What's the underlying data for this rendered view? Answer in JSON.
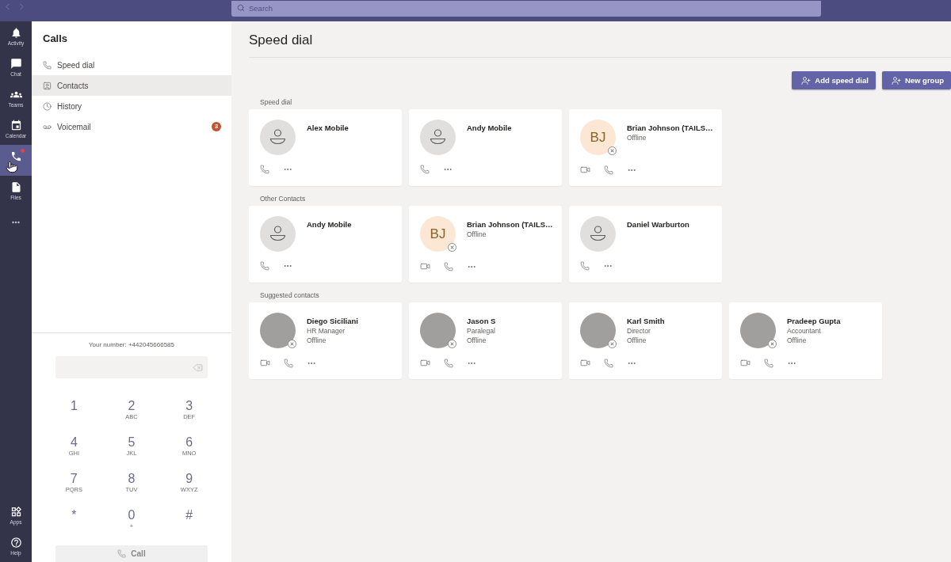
{
  "top_bar": {
    "history_buttons": [
      {
        "disabled": true
      },
      {
        "disabled": true
      }
    ],
    "search": {
      "placeholder": "Search"
    }
  },
  "app_bar": {
    "items": [
      {
        "label": "Activity",
        "selected": false,
        "notification": false
      },
      {
        "label": "Chat",
        "selected": false,
        "notification": false
      },
      {
        "label": "Teams",
        "selected": false,
        "notification": false
      },
      {
        "label": "Calendar",
        "selected": false,
        "notification": false
      },
      {
        "selected": true,
        "notification": true
      },
      {
        "label": "Files",
        "selected": false,
        "notification": false
      }
    ],
    "bottom_items": [
      {
        "label": "Apps"
      },
      {
        "label": "Help"
      }
    ]
  },
  "calls_panel": {
    "title": "Calls",
    "nav": [
      {
        "label": "Speed dial",
        "selected": false
      },
      {
        "label": "Contacts",
        "selected": true
      },
      {
        "label": "History",
        "selected": false
      },
      {
        "label": "Voicemail",
        "selected": false,
        "badge": "3"
      }
    ],
    "your_number": "Your number: +442045666585",
    "dialpad": [
      {
        "digit": "1"
      },
      {
        "digit": "2",
        "letters": "ABC"
      },
      {
        "digit": "3",
        "letters": "DEF"
      },
      {
        "digit": "4",
        "letters": "GHI"
      },
      {
        "digit": "5",
        "letters": "JKL"
      },
      {
        "digit": "6",
        "letters": "MNO"
      },
      {
        "digit": "7",
        "letters": "PQRS"
      },
      {
        "digit": "8",
        "letters": "TUV"
      },
      {
        "digit": "9",
        "letters": "WXYZ"
      },
      {
        "digit": "*"
      },
      {
        "digit": "0",
        "letters": "+"
      },
      {
        "digit": "#"
      }
    ],
    "call_button": {
      "label": "Call",
      "disabled": true
    }
  },
  "main": {
    "title": "Speed dial",
    "buttons": [
      {
        "label": "Add speed dial"
      },
      {
        "label": "New group"
      }
    ],
    "sections": [
      {
        "label": "Speed dial",
        "contacts": [
          {
            "name": "Alex Mobile",
            "avatar": {
              "kind": "placeholder"
            },
            "offline": false,
            "video_call": false
          },
          {
            "name": "Andy Mobile",
            "avatar": {
              "kind": "placeholder"
            },
            "offline": false,
            "video_call": false
          },
          {
            "name": "Brian Johnson (TAILS…",
            "avatar": {
              "kind": "initials",
              "initials": "BJ"
            },
            "offline": true,
            "video_call": true,
            "lines": [
              "Offline"
            ]
          }
        ]
      },
      {
        "label": "Other Contacts",
        "contacts": [
          {
            "name": "Andy Mobile",
            "avatar": {
              "kind": "placeholder"
            },
            "offline": false,
            "video_call": false
          },
          {
            "name": "Brian Johnson (TAILS…",
            "avatar": {
              "kind": "initials",
              "initials": "BJ"
            },
            "offline": true,
            "video_call": true,
            "lines": [
              "Offline"
            ]
          },
          {
            "name": "Daniel Warburton",
            "avatar": {
              "kind": "placeholder"
            },
            "offline": false,
            "video_call": false
          }
        ]
      },
      {
        "label": "Suggested contacts",
        "contacts": [
          {
            "name": "Diego Siciliani",
            "avatar": {
              "kind": "photo"
            },
            "offline": true,
            "video_call": true,
            "lines": [
              "HR Manager",
              "Offline"
            ]
          },
          {
            "name": "Jason S",
            "avatar": {
              "kind": "photo"
            },
            "offline": true,
            "video_call": true,
            "lines": [
              "Paralegal",
              "Offline"
            ]
          },
          {
            "name": "Karl Smith",
            "avatar": {
              "kind": "photo"
            },
            "offline": true,
            "video_call": true,
            "lines": [
              "Director",
              "Offline"
            ]
          },
          {
            "name": "Pradeep Gupta",
            "avatar": {
              "kind": "photo"
            },
            "offline": true,
            "video_call": true,
            "lines": [
              "Accountant",
              "Offline"
            ]
          }
        ]
      }
    ]
  }
}
